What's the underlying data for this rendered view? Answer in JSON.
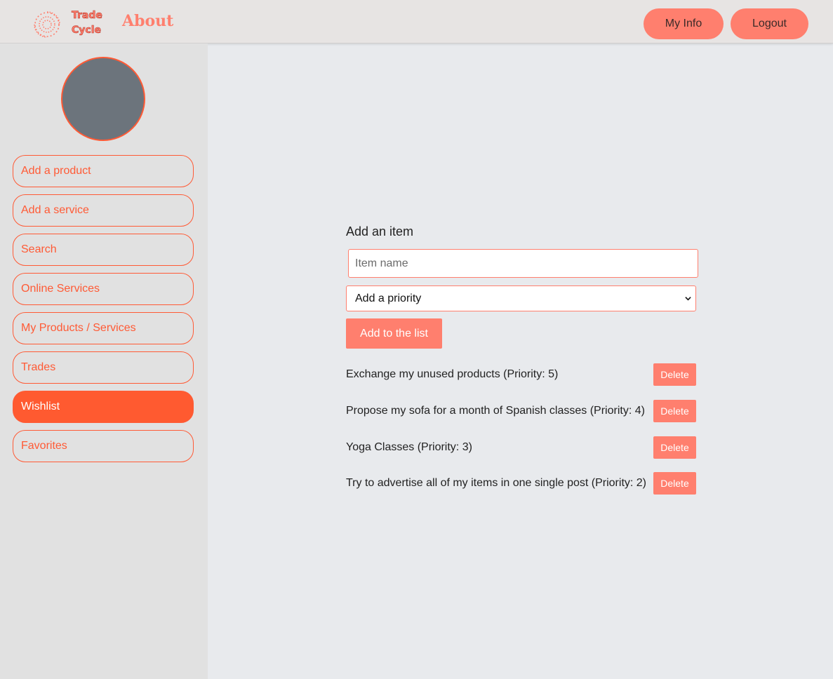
{
  "header": {
    "logo_line1": "Trade",
    "logo_line2": "Cycle",
    "page_title": "About",
    "my_info_label": "My Info",
    "logout_label": "Logout"
  },
  "sidebar": {
    "items": [
      {
        "label": "Add a product",
        "active": false
      },
      {
        "label": "Add a service",
        "active": false
      },
      {
        "label": "Search",
        "active": false
      },
      {
        "label": "Online Services",
        "active": false
      },
      {
        "label": "My Products / Services",
        "active": false
      },
      {
        "label": "Trades",
        "active": false
      },
      {
        "label": "Wishlist",
        "active": true
      },
      {
        "label": "Favorites",
        "active": false
      }
    ]
  },
  "form": {
    "title": "Add an item",
    "item_placeholder": "Item name",
    "priority_selected": "Add a priority",
    "add_button": "Add to the list"
  },
  "wishlist": [
    {
      "text": "Exchange my unused products (Priority: 5)",
      "delete_label": "Delete"
    },
    {
      "text": "Propose my sofa for a month of Spanish classes (Priority: 4)",
      "delete_label": "Delete"
    },
    {
      "text": "Yoga Classes (Priority: 3)",
      "delete_label": "Delete"
    },
    {
      "text": "Try to advertise all of my items in one single post (Priority: 2)",
      "delete_label": "Delete"
    }
  ],
  "colors": {
    "accent": "#ff7f6e",
    "active": "#ff5a30",
    "avatar": "#6c747c"
  }
}
